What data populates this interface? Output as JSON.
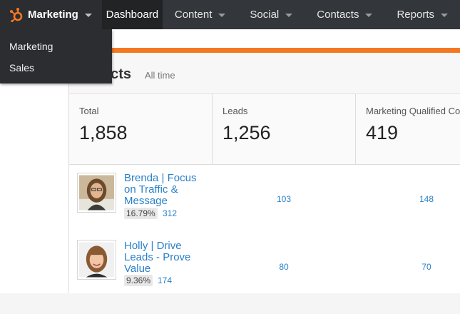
{
  "nav": {
    "brand_label": "Marketing",
    "items": [
      {
        "label": "Dashboard"
      },
      {
        "label": "Content"
      },
      {
        "label": "Social"
      },
      {
        "label": "Contacts"
      },
      {
        "label": "Reports"
      }
    ]
  },
  "dropdown": {
    "items": [
      {
        "label": "Marketing"
      },
      {
        "label": "Sales"
      }
    ]
  },
  "panel": {
    "title": "acts",
    "subtitle": "All time"
  },
  "stats": [
    {
      "label": "Total",
      "value": "1,858"
    },
    {
      "label": "Leads",
      "value": "1,256"
    },
    {
      "label": "Marketing Qualified Co",
      "value": "419"
    }
  ],
  "contacts": [
    {
      "name": "Brenda | Focus on Traffic & Message",
      "percent": "16.79%",
      "count": "312",
      "col1": "103",
      "col2": "148"
    },
    {
      "name": "Holly | Drive Leads - Prove Value",
      "percent": "9.36%",
      "count": "174",
      "col1": "80",
      "col2": "70"
    }
  ],
  "colors": {
    "accent": "#f57722",
    "link": "#2a80c9",
    "nav_bg": "#33363a"
  }
}
